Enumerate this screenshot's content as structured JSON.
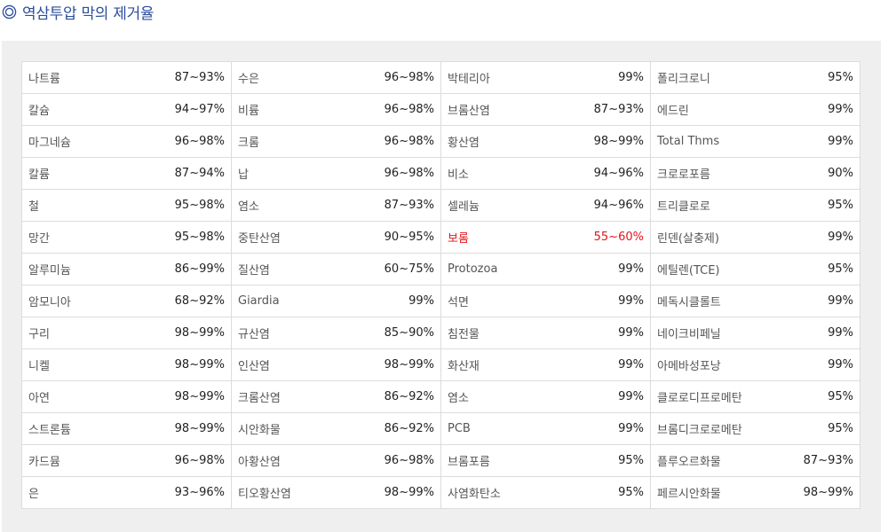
{
  "title": "역삼투압 막의 제거율",
  "accent_color": "#2d4f9c",
  "highlight_color": "#e0161b",
  "columns": [
    [
      {
        "name": "나트륨",
        "rate": "87~93%"
      },
      {
        "name": "칼슘",
        "rate": "94~97%"
      },
      {
        "name": "마그네슘",
        "rate": "96~98%"
      },
      {
        "name": "칼륨",
        "rate": "87~94%"
      },
      {
        "name": "철",
        "rate": "95~98%"
      },
      {
        "name": "망간",
        "rate": "95~98%"
      },
      {
        "name": "알루미늄",
        "rate": "86~99%"
      },
      {
        "name": "암모니아",
        "rate": "68~92%"
      },
      {
        "name": "구리",
        "rate": "98~99%"
      },
      {
        "name": "니켈",
        "rate": "98~99%"
      },
      {
        "name": "아연",
        "rate": "98~99%"
      },
      {
        "name": "스트론튬",
        "rate": "98~99%"
      },
      {
        "name": "카드뮴",
        "rate": "96~98%"
      },
      {
        "name": "은",
        "rate": "93~96%"
      }
    ],
    [
      {
        "name": "수은",
        "rate": "96~98%"
      },
      {
        "name": "비륨",
        "rate": "96~98%"
      },
      {
        "name": "크롬",
        "rate": "96~98%"
      },
      {
        "name": "납",
        "rate": "96~98%"
      },
      {
        "name": "염소",
        "rate": "87~93%"
      },
      {
        "name": "중탄산염",
        "rate": "90~95%"
      },
      {
        "name": "질산염",
        "rate": "60~75%"
      },
      {
        "name": "Giardia",
        "rate": "99%"
      },
      {
        "name": "규산염",
        "rate": "85~90%"
      },
      {
        "name": "인산염",
        "rate": "98~99%"
      },
      {
        "name": "크롬산염",
        "rate": "86~92%"
      },
      {
        "name": "시안화물",
        "rate": "86~92%"
      },
      {
        "name": "아황산염",
        "rate": "96~98%"
      },
      {
        "name": "티오황산염",
        "rate": "98~99%"
      }
    ],
    [
      {
        "name": "박테리아",
        "rate": "99%"
      },
      {
        "name": "브롬산염",
        "rate": "87~93%"
      },
      {
        "name": "황산염",
        "rate": "98~99%"
      },
      {
        "name": "비소",
        "rate": "94~96%"
      },
      {
        "name": "셀레늄",
        "rate": "94~96%"
      },
      {
        "name": "보롬",
        "rate": "55~60%",
        "highlight": true
      },
      {
        "name": "Protozoa",
        "rate": "99%"
      },
      {
        "name": "석면",
        "rate": "99%"
      },
      {
        "name": "침전물",
        "rate": "99%"
      },
      {
        "name": "화산재",
        "rate": "99%"
      },
      {
        "name": "염소",
        "rate": "99%"
      },
      {
        "name": "PCB",
        "rate": "99%"
      },
      {
        "name": "브롬포름",
        "rate": "95%"
      },
      {
        "name": "사염화탄소",
        "rate": "95%"
      }
    ],
    [
      {
        "name": "폴리크로니",
        "rate": "95%"
      },
      {
        "name": "에드린",
        "rate": "99%"
      },
      {
        "name": "Total Thms",
        "rate": "99%"
      },
      {
        "name": "크로로포름",
        "rate": "90%"
      },
      {
        "name": "트리클로로",
        "rate": "95%"
      },
      {
        "name": "린덴(살충제)",
        "rate": "99%"
      },
      {
        "name": "에틸렌(TCE)",
        "rate": "95%"
      },
      {
        "name": "메독시클롤트",
        "rate": "99%"
      },
      {
        "name": "네이크비페닐",
        "rate": "99%"
      },
      {
        "name": "아메바성포낭",
        "rate": "99%"
      },
      {
        "name": "클로로디프로메탄",
        "rate": "95%"
      },
      {
        "name": "브롬디크로로메탄",
        "rate": "95%"
      },
      {
        "name": "플루오르화물",
        "rate": "87~93%"
      },
      {
        "name": "페르시안화물",
        "rate": "98~99%"
      }
    ]
  ]
}
